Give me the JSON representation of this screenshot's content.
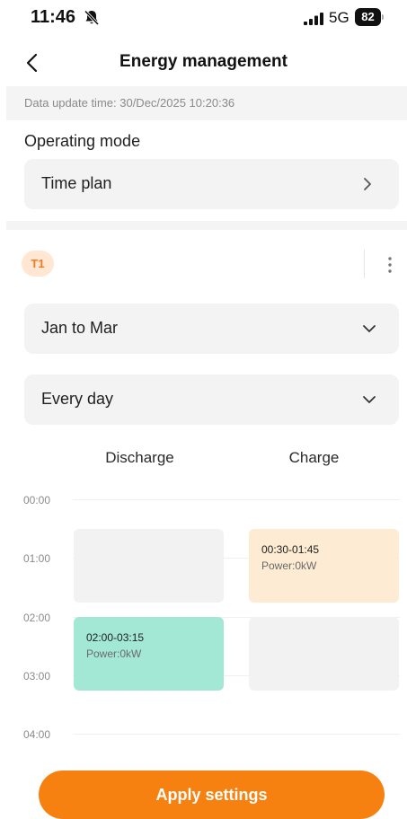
{
  "status_bar": {
    "time": "11:46",
    "network": "5G",
    "battery": "82",
    "icons": [
      "bell-slash-icon",
      "signal-bars-icon",
      "battery-icon"
    ]
  },
  "header": {
    "title": "Energy management",
    "back_icon": "chevron-left-icon"
  },
  "update_time": "Data update time: 30/Dec/2025 10:20:36",
  "operating_mode": {
    "label": "Operating mode",
    "value": "Time plan",
    "icon": "chevron-right-icon"
  },
  "plan": {
    "tag": "T1",
    "more_icon": "more-vertical-icon",
    "months": "Jan to Mar",
    "days": "Every day",
    "dropdown_icon": "chevron-down-icon"
  },
  "schedule": {
    "columns": [
      "Discharge",
      "Charge"
    ],
    "time_labels": [
      "00:00",
      "01:00",
      "02:00",
      "03:00",
      "04:00"
    ],
    "slots": [
      {
        "type": "Charge",
        "range": "00:30-01:45",
        "power": "Power:0kW",
        "color": "#fdebd3"
      },
      {
        "type": "Discharge",
        "range": "02:00-03:15",
        "power": "Power:0kW",
        "color": "#a3e8d4"
      }
    ]
  },
  "apply_button": {
    "label": "Apply settings",
    "color": "#f68110"
  }
}
